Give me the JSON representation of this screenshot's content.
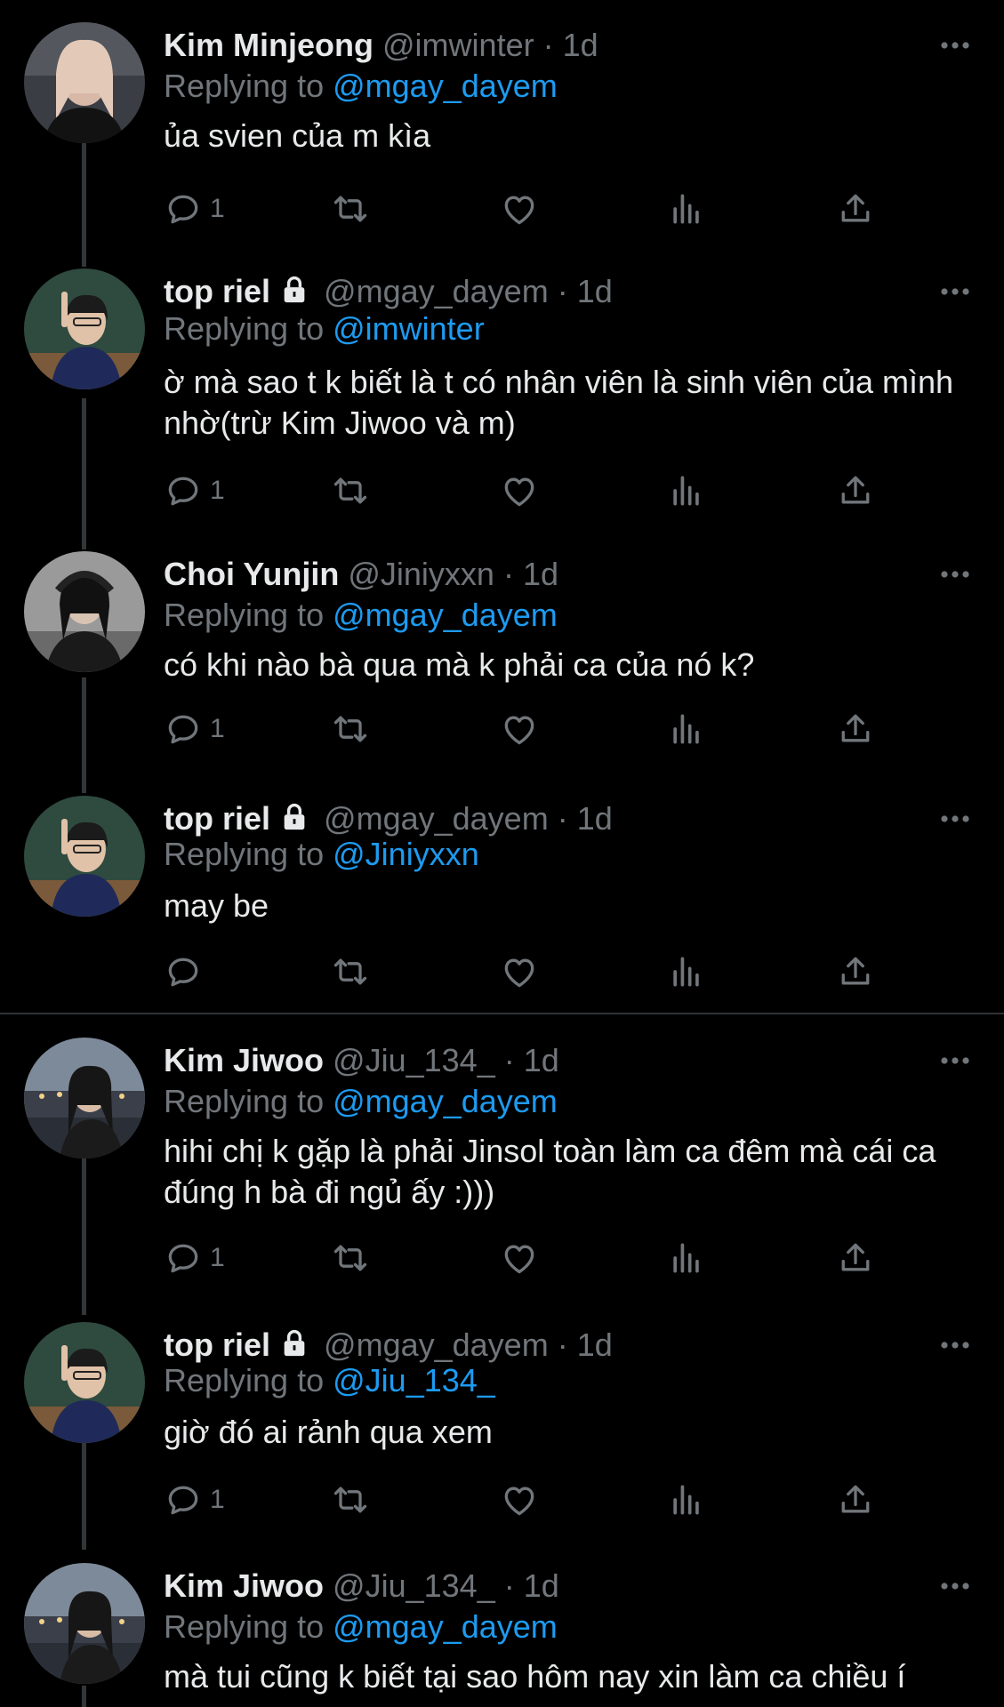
{
  "colors": {
    "background": "#000000",
    "text": "#e7e9ea",
    "muted": "#71767b",
    "link": "#1d9bf0",
    "line": "#333639"
  },
  "tweets": [
    {
      "name": "Kim Minjeong",
      "handle": "@imwinter",
      "sep": "·",
      "time": "1d",
      "replying_label": "Replying to",
      "reply_to": "@mgay_dayem",
      "text": "ủa svien của m kìa",
      "reply_count": "1",
      "locked": false
    },
    {
      "name": "top riel",
      "handle": "@mgay_dayem",
      "sep": "·",
      "time": "1d",
      "replying_label": "Replying to",
      "reply_to": "@imwinter",
      "text": "ờ mà sao t k biết là t có nhân viên là sinh viên của mình nhờ(trừ Kim Jiwoo và m)",
      "reply_count": "1",
      "locked": true
    },
    {
      "name": "Choi Yunjin",
      "handle": "@Jiniyxxn",
      "sep": "·",
      "time": "1d",
      "replying_label": "Replying to",
      "reply_to": "@mgay_dayem",
      "text": "có khi nào bà qua mà k phải ca của nó k?",
      "reply_count": "1",
      "locked": false
    },
    {
      "name": "top riel",
      "handle": "@mgay_dayem",
      "sep": "·",
      "time": "1d",
      "replying_label": "Replying to",
      "reply_to": "@Jiniyxxn",
      "text": "may be",
      "reply_count": "",
      "locked": true
    },
    {
      "name": "Kim Jiwoo",
      "handle": "@Jiu_134_",
      "sep": "·",
      "time": "1d",
      "replying_label": "Replying to",
      "reply_to": "@mgay_dayem",
      "text": "hihi chị k gặp là phải Jinsol toàn làm ca đêm mà cái ca đúng h bà đi ngủ ấy :)))",
      "reply_count": "1",
      "locked": false
    },
    {
      "name": "top riel",
      "handle": "@mgay_dayem",
      "sep": "·",
      "time": "1d",
      "replying_label": "Replying to",
      "reply_to": "@Jiu_134_",
      "text": "giờ đó ai rảnh qua xem",
      "reply_count": "1",
      "locked": true
    },
    {
      "name": "Kim Jiwoo",
      "handle": "@Jiu_134_",
      "sep": "·",
      "time": "1d",
      "replying_label": "Replying to",
      "reply_to": "@mgay_dayem",
      "text": "mà tui cũng k biết tại sao hôm nay xin làm ca chiều í",
      "reply_count": "",
      "locked": false
    }
  ]
}
